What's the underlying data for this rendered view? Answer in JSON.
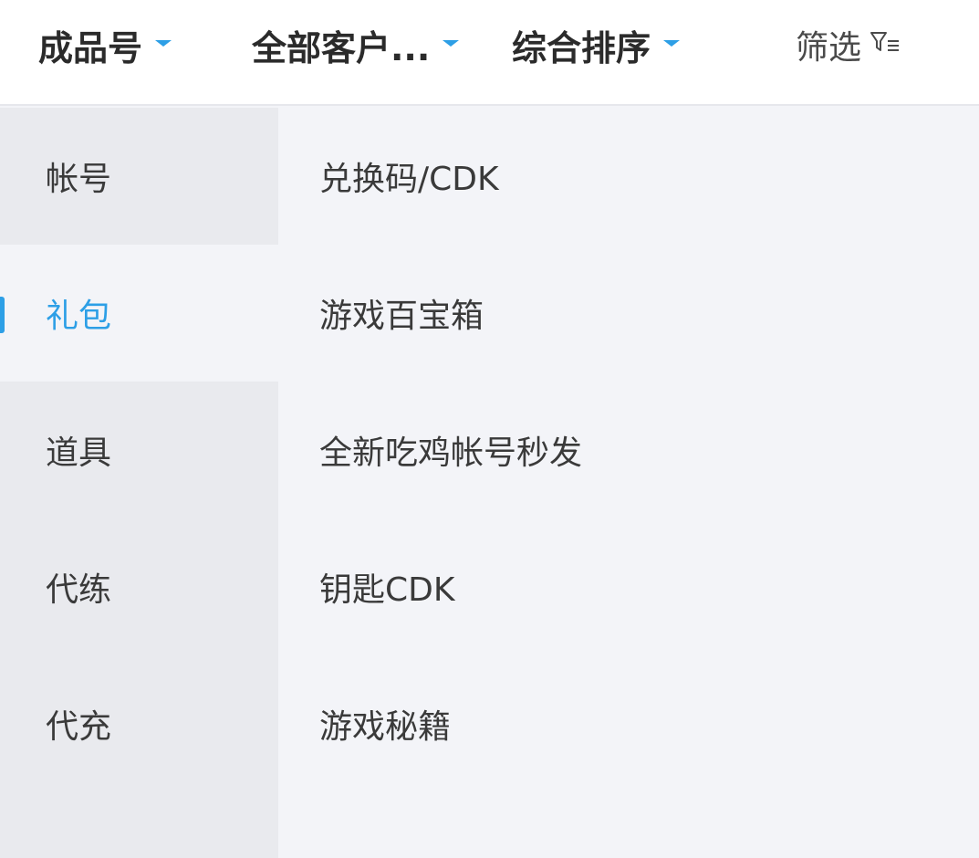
{
  "top_filters": {
    "product_type": {
      "label": "成品号",
      "icon": "caret-down-icon"
    },
    "customer": {
      "label": "全部客户...",
      "icon": "caret-down-icon"
    },
    "sort": {
      "label": "综合排序",
      "icon": "caret-down-icon"
    },
    "filter": {
      "label": "筛选",
      "icon": "filter-icon"
    },
    "accent_color": "#2d9fe6"
  },
  "sidebar": {
    "selected": "礼包",
    "items": [
      {
        "label": "帐号"
      },
      {
        "label": "礼包"
      },
      {
        "label": "道具"
      },
      {
        "label": "代练"
      },
      {
        "label": "代充"
      }
    ]
  },
  "subcategories": {
    "items": [
      {
        "label": "兑换码/CDK"
      },
      {
        "label": "游戏百宝箱"
      },
      {
        "label": "全新吃鸡帐号秒发"
      },
      {
        "label": "钥匙CDK"
      },
      {
        "label": "游戏秘籍"
      }
    ]
  }
}
